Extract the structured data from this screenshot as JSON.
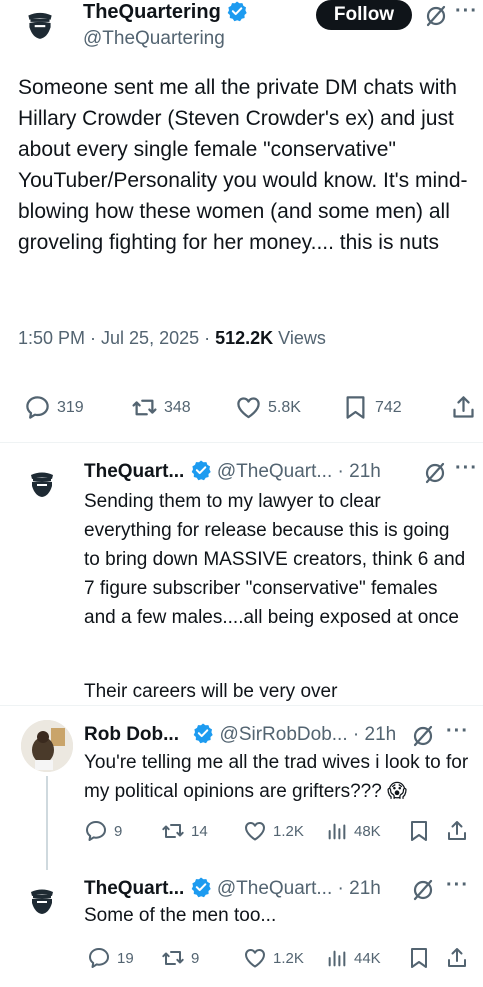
{
  "main_tweet": {
    "author_name": "TheQuartering",
    "author_handle": "@TheQuartering",
    "follow_label": "Follow",
    "text": "Someone sent me all the private DM chats with Hillary Crowder (Steven Crowder's ex) and just about every single female \"conservative\" YouTuber/Personality you would know. It's mind-blowing how these women (and some men) all groveling fighting for her money.... this is nuts",
    "time": "1:50 PM · Jul 25, 2025 · ",
    "views_count": "512.2K",
    "views_label": " Views",
    "replies": "319",
    "reposts": "348",
    "likes": "5.8K",
    "bookmarks": "742"
  },
  "reply1": {
    "author_name": "TheQuart...",
    "author_handle": "@TheQuart...",
    "time": "· 21h",
    "text_p1": "Sending them to my lawyer to clear everything for release because this is going to bring down MASSIVE creators, think 6 and 7 figure subscriber \"conservative\" females and a few males....all being exposed at once",
    "text_p2": "Their careers will be very over"
  },
  "reply2": {
    "author_name": "Rob Dob...",
    "author_handle": "@SirRobDob...",
    "time": "· 21h",
    "text": "You're telling me all the trad wives i look to for my political opinions are grifters??? 😱",
    "replies": "9",
    "reposts": "14",
    "likes": "1.2K",
    "views": "48K"
  },
  "reply3": {
    "author_name": "TheQuart...",
    "author_handle": "@TheQuart...",
    "time": "· 21h",
    "text": "Some of the men too...",
    "replies": "19",
    "reposts": "9",
    "likes": "1.2K",
    "views": "44K"
  },
  "colors": {
    "text": "#0f1419",
    "muted": "#536471",
    "verified": "#1d9bf0",
    "divider": "#eff3f4"
  },
  "icons": [
    "avatar-icon",
    "verified-icon",
    "grok-icon",
    "more-icon",
    "reply-icon",
    "repost-icon",
    "like-icon",
    "bookmark-icon",
    "share-icon",
    "views-icon"
  ]
}
